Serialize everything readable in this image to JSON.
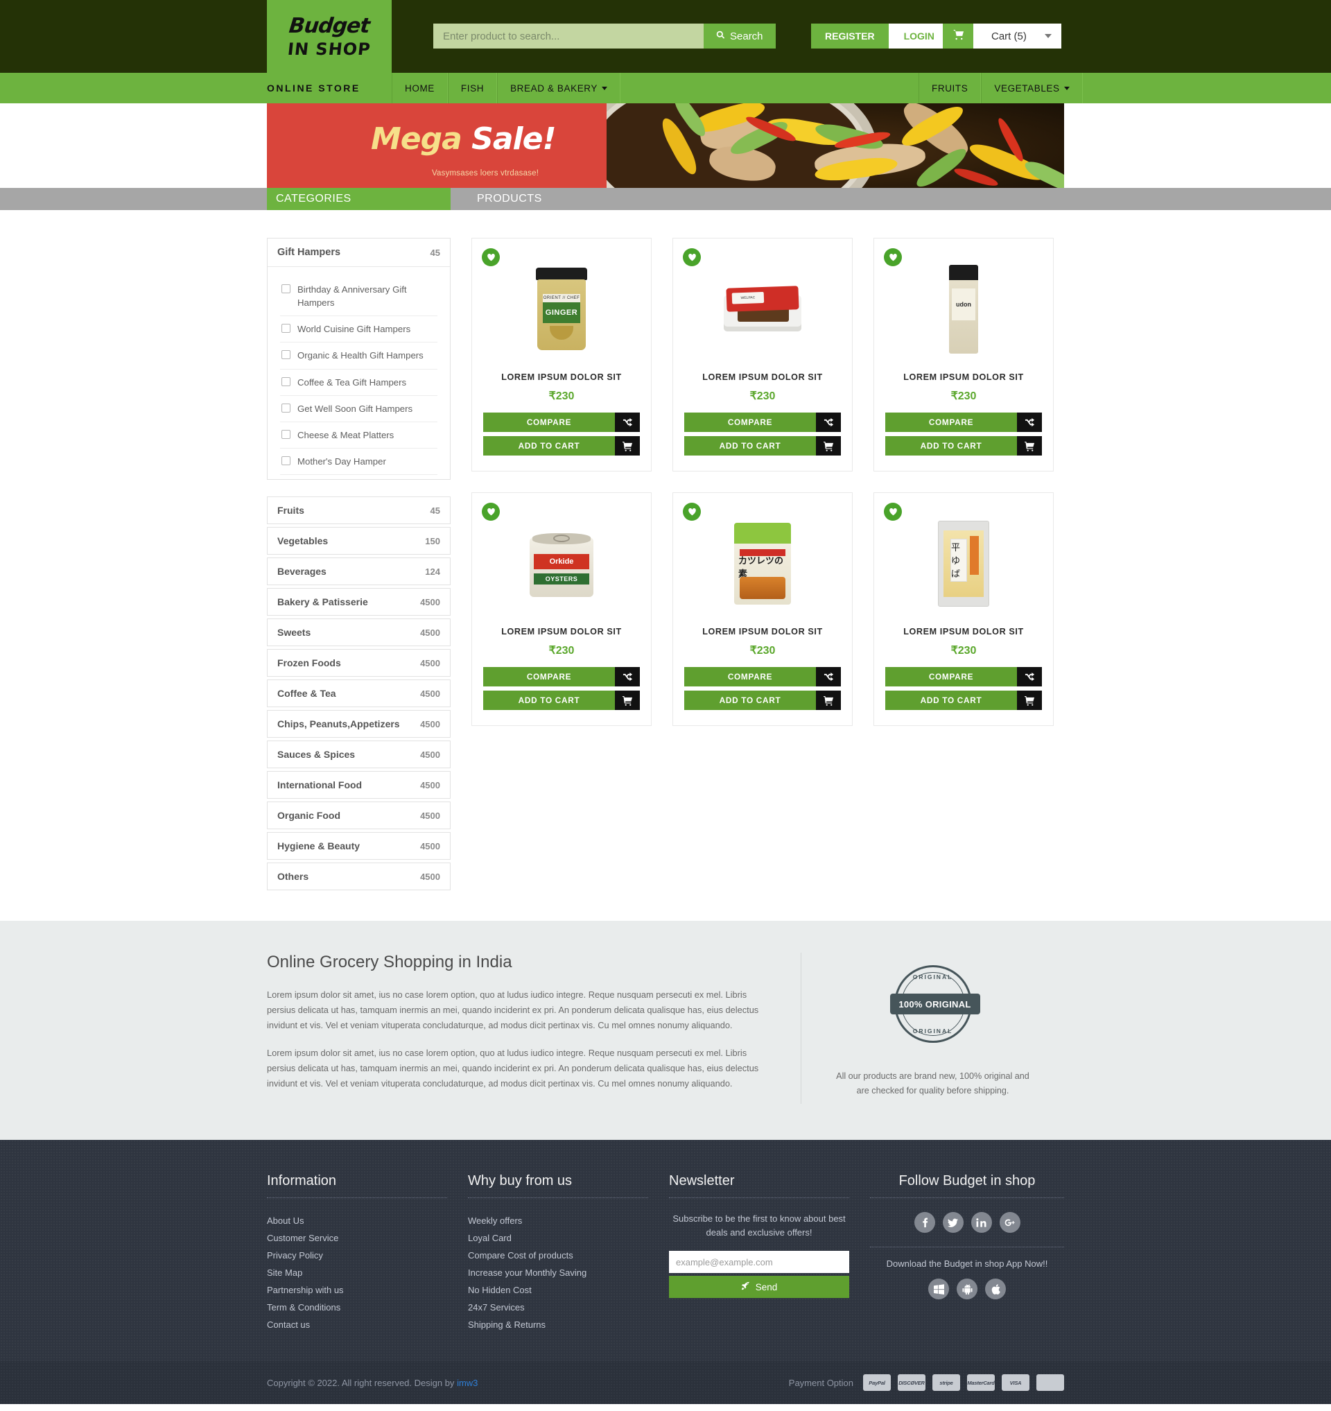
{
  "header": {
    "logo_line1": "Budget",
    "logo_line2": "IN SHOP",
    "search_placeholder": "Enter product to search...",
    "search_value": "",
    "search_button": "Search",
    "register_label": "REGISTER",
    "login_label": "LOGIN",
    "cart_label": "Cart (5)",
    "cart_count": "5"
  },
  "nav": {
    "store_label": "ONLINE STORE",
    "left_items": [
      {
        "label": "HOME",
        "caret": false
      },
      {
        "label": "FISH",
        "caret": false
      },
      {
        "label": "BREAD & BAKERY",
        "caret": true
      }
    ],
    "right_items": [
      {
        "label": "FRUITS",
        "caret": false
      },
      {
        "label": "VEGETABLES",
        "caret": true
      }
    ]
  },
  "banner": {
    "title_part1": "Mega ",
    "title_part2": "Sale!",
    "subtitle": "Vasymsases loers vtrdasase!"
  },
  "subbar": {
    "categories_title": "CATEGORIES",
    "products_title": "PRODUCTS"
  },
  "sidebar": {
    "gift_hampers": {
      "name": "Gift Hampers",
      "count": "45",
      "subcategories": [
        "Birthday & Anniversary Gift Hampers",
        "World Cuisine Gift Hampers",
        "Organic & Health Gift Hampers",
        "Coffee & Tea Gift Hampers",
        "Get Well Soon Gift Hampers",
        "Cheese & Meat Platters",
        "Mother's Day Hamper"
      ]
    },
    "categories": [
      {
        "name": "Fruits",
        "count": "45"
      },
      {
        "name": "Vegetables",
        "count": "150"
      },
      {
        "name": "Beverages",
        "count": "124"
      },
      {
        "name": "Bakery & Patisserie",
        "count": "4500"
      },
      {
        "name": "Sweets",
        "count": "4500"
      },
      {
        "name": "Frozen Foods",
        "count": "4500"
      },
      {
        "name": "Coffee & Tea",
        "count": "4500"
      },
      {
        "name": "Chips, Peanuts,Appetizers",
        "count": "4500"
      },
      {
        "name": "Sauces & Spices",
        "count": "4500"
      },
      {
        "name": "International Food",
        "count": "4500"
      },
      {
        "name": "Organic Food",
        "count": "4500"
      },
      {
        "name": "Hygiene & Beauty",
        "count": "4500"
      },
      {
        "name": "Others",
        "count": "4500"
      }
    ]
  },
  "products": {
    "compare_label": "COMPARE",
    "add_to_cart_label": "ADD TO CART",
    "items": [
      {
        "title": "LOREM IPSUM DOLOR SIT",
        "price": "₹230",
        "art": "jar",
        "art_text": "GINGER",
        "art_text2": "ORIENT // CHEF"
      },
      {
        "title": "LOREM IPSUM DOLOR SIT",
        "price": "₹230",
        "art": "tray",
        "art_text": "WELPAC",
        "art_text2": ""
      },
      {
        "title": "LOREM IPSUM DOLOR SIT",
        "price": "₹230",
        "art": "udon",
        "art_text": "udon",
        "art_text2": ""
      },
      {
        "title": "LOREM IPSUM DOLOR SIT",
        "price": "₹230",
        "art": "can",
        "art_text": "Orkide",
        "art_text2": "OYSTERS"
      },
      {
        "title": "LOREM IPSUM DOLOR SIT",
        "price": "₹230",
        "art": "pouch",
        "art_text": "カツレツの素",
        "art_text2": ""
      },
      {
        "title": "LOREM IPSUM DOLOR SIT",
        "price": "₹230",
        "art": "yuba",
        "art_text": "平ゆば",
        "art_text2": ""
      }
    ]
  },
  "info": {
    "heading": "Online Grocery Shopping in India",
    "paragraph1": "Lorem ipsum dolor sit amet, ius no case lorem option, quo at ludus iudico integre. Reque nusquam persecuti ex mel. Libris persius delicata ut has, tamquam inermis an mei, quando inciderint ex pri. An ponderum delicata qualisque has, eius delectus invidunt et vis. Vel et veniam vituperata concludaturque, ad modus dicit pertinax vis. Cu mel omnes nonumy aliquando.",
    "paragraph2": "Lorem ipsum dolor sit amet, ius no case lorem option, quo at ludus iudico integre. Reque nusquam persecuti ex mel. Libris persius delicata ut has, tamquam inermis an mei, quando inciderint ex pri. An ponderum delicata qualisque has, eius delectus invidunt et vis. Vel et veniam vituperata concludaturque, ad modus dicit pertinax vis. Cu mel omnes nonumy aliquando.",
    "stamp_top": "ORIGINAL",
    "stamp_band": "100% ORIGINAL",
    "stamp_bottom": "ORIGINAL",
    "stamp_note": "All our products are brand new, 100% original and are checked for quality before shipping."
  },
  "footer": {
    "information": {
      "heading": "Information",
      "links": [
        "About Us",
        "Customer Service",
        "Privacy Policy",
        "Site Map",
        "Partnership with us",
        "Term & Conditions",
        "Contact us"
      ]
    },
    "why_buy": {
      "heading": "Why buy from us",
      "links": [
        "Weekly offers",
        "Loyal Card",
        "Compare Cost of products",
        "Increase your Monthly Saving",
        "No Hidden Cost",
        "24x7 Services",
        "Shipping & Returns"
      ]
    },
    "newsletter": {
      "heading": "Newsletter",
      "text": "Subscribe to be the first to know about best deals and exclusive offers!",
      "placeholder": "example@example.com",
      "value": "",
      "send_label": "Send"
    },
    "follow": {
      "heading": "Follow Budget in shop",
      "socials": [
        "facebook-icon",
        "twitter-icon",
        "linkedin-icon",
        "google-plus-icon"
      ],
      "app_text": "Download the Budget in shop App Now!!",
      "apps": [
        "windows-icon",
        "android-icon",
        "apple-icon"
      ]
    }
  },
  "copyright": {
    "text": "Copyright © 2022. All right reserved. Design by ",
    "designer": "imw3",
    "payment_label": "Payment Option",
    "payment_methods": [
      "PayPal",
      "DISCØVER",
      "stripe",
      "MasterCard",
      "VISA",
      "card"
    ]
  }
}
